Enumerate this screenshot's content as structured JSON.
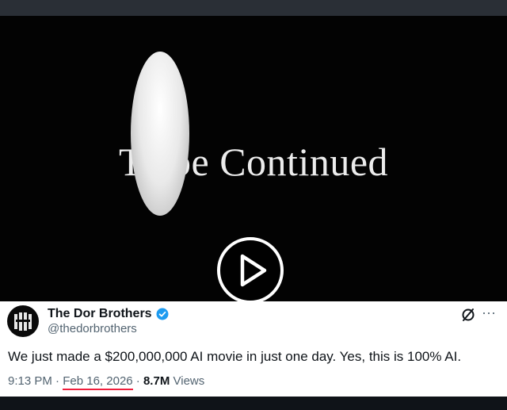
{
  "video": {
    "title_text": "To be Continued"
  },
  "tweet": {
    "display_name": "The Dor Brothers",
    "handle": "@thedorbrothers",
    "text": "We just made a $200,000,000 AI movie in just one day. Yes, this is 100% AI.",
    "time": "9:13 PM",
    "separator": "·",
    "date": "Feb 16, 2026",
    "views_count": "8.7M",
    "views_label": "Views",
    "more_label": "···"
  },
  "icons": {
    "play": "play-icon",
    "verified": "verified-badge-icon",
    "grok": "grok-icon",
    "more": "more-icon",
    "avatar": "avatar-logo"
  },
  "colors": {
    "verified": "#1d9bf0",
    "underline": "#f01e3c",
    "secondary_text": "#536471",
    "primary_text": "#0f1419"
  }
}
